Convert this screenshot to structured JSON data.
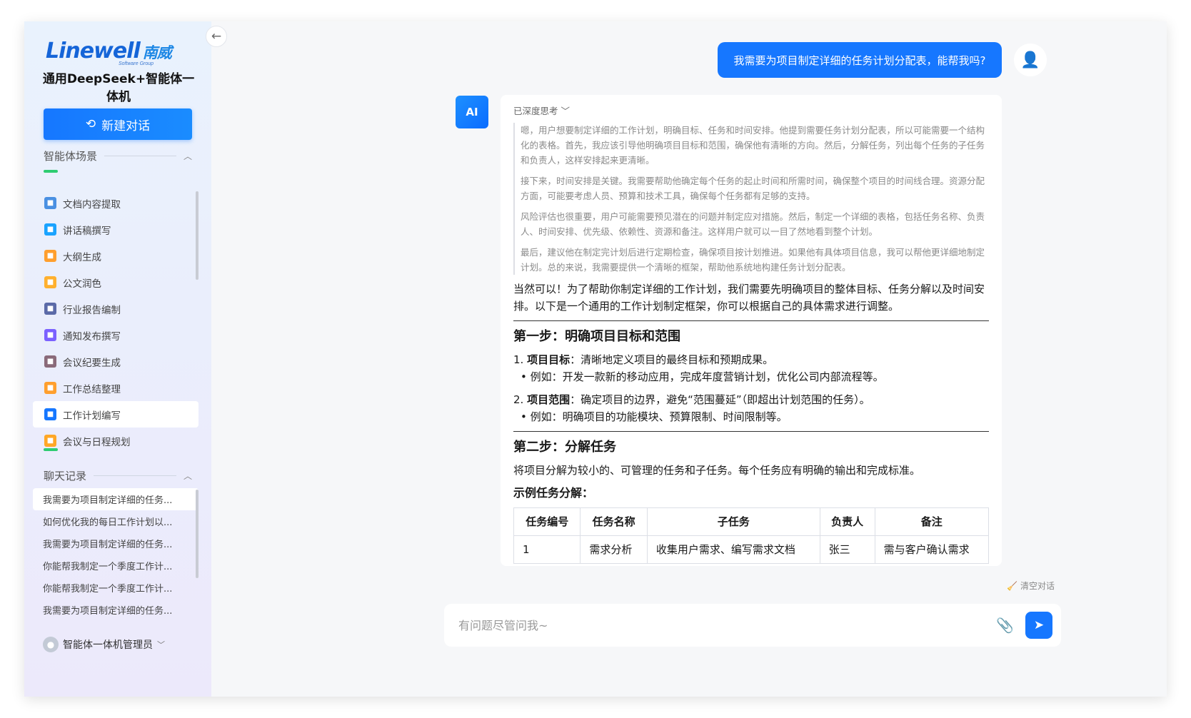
{
  "brand": {
    "logo_en": "Linewell",
    "logo_cn": "南威",
    "logo_sub": "Software Group",
    "app_name": "通用DeepSeek+智能体一体机"
  },
  "sidebar": {
    "new_chat_label": "新建对话",
    "scene_header": "智能体场景",
    "scenes": [
      {
        "label": "文档内容提取",
        "icon": "document-extract-icon",
        "color": "#4a90e2"
      },
      {
        "label": "讲话稿撰写",
        "icon": "speech-icon",
        "color": "#1aa3ff"
      },
      {
        "label": "大纲生成",
        "icon": "outline-icon",
        "color": "#ff9f2e"
      },
      {
        "label": "公文润色",
        "icon": "polish-icon",
        "color": "#ffb02e"
      },
      {
        "label": "行业报告编制",
        "icon": "report-icon",
        "color": "#5b6aa8"
      },
      {
        "label": "通知发布撰写",
        "icon": "notice-icon",
        "color": "#7b61ff"
      },
      {
        "label": "会议纪要生成",
        "icon": "minutes-icon",
        "color": "#8a6a7a"
      },
      {
        "label": "工作总结整理",
        "icon": "summary-icon",
        "color": "#ff9f2e"
      },
      {
        "label": "工作计划编写",
        "icon": "plan-icon",
        "color": "#1677ff"
      },
      {
        "label": "会议与日程规划",
        "icon": "schedule-icon",
        "color": "#ffa726"
      }
    ],
    "history_header": "聊天记录",
    "history": [
      "我需要为项目制定详细的任务...",
      "如何优化我的每日工作计划以...",
      "我需要为项目制定详细的任务...",
      "你能帮我制定一个季度工作计...",
      "你能帮我制定一个季度工作计...",
      "我需要为项目制定详细的任务..."
    ],
    "user_name": "智能体一体机管理员"
  },
  "chat": {
    "user_message": "我需要为项目制定详细的任务计划分配表，能帮我吗?",
    "ai_avatar_label": "AI",
    "think_label": "已深度思考",
    "think_paragraphs": [
      "嗯，用户想要制定详细的工作计划，明确目标、任务和时间安排。他提到需要任务计划分配表，所以可能需要一个结构化的表格。首先，我应该引导他明确项目目标和范围，确保他有清晰的方向。然后，分解任务，列出每个任务的子任务和负责人，这样安排起来更清晰。",
      "接下来，时间安排是关键。我需要帮助他确定每个任务的起止时间和所需时间，确保整个项目的时间线合理。资源分配方面，可能要考虑人员、预算和技术工具，确保每个任务都有足够的支持。",
      "风险评估也很重要，用户可能需要预见潜在的问题并制定应对措施。然后，制定一个详细的表格，包括任务名称、负责人、时间安排、优先级、依赖性、资源和备注。这样用户就可以一目了然地看到整个计划。",
      "最后，建议他在制定完计划后进行定期检查，确保项目按计划推进。如果他有具体项目信息，我可以帮他更详细地制定计划。总的来说，我需要提供一个清晰的框架，帮助他系统地构建任务计划分配表。"
    ],
    "intro": "当然可以！为了帮助你制定详细的工作计划，我们需要先明确项目的整体目标、任务分解以及时间安排。以下是一个通用的工作计划制定框架，你可以根据自己的具体需求进行调整。",
    "step1_title": "第一步：明确项目目标和范围",
    "step1_item1_label": "项目目标",
    "step1_item1_text": "：清晰地定义项目的最终目标和预期成果。",
    "step1_item1_example": "例如：开发一款新的移动应用，完成年度营销计划，优化公司内部流程等。",
    "step1_item2_label": "项目范围",
    "step1_item2_text": "：确定项目的边界，避免“范围蔓延”（即超出计划范围的任务）。",
    "step1_item2_example": "例如：明确项目的功能模块、预算限制、时间限制等。",
    "step2_title": "第二步：分解任务",
    "step2_text": "将项目分解为较小的、可管理的任务和子任务。每个任务应有明确的输出和完成标准。",
    "table_title": "示例任务分解：",
    "table_headers": [
      "任务编号",
      "任务名称",
      "子任务",
      "负责人",
      "备注"
    ],
    "table_rows": [
      [
        "1",
        "需求分析",
        "收集用户需求、编写需求文档",
        "张三",
        "需与客户确认需求"
      ]
    ]
  },
  "footer": {
    "clear_label": "清空对话",
    "input_placeholder": "有问题尽管问我~"
  }
}
